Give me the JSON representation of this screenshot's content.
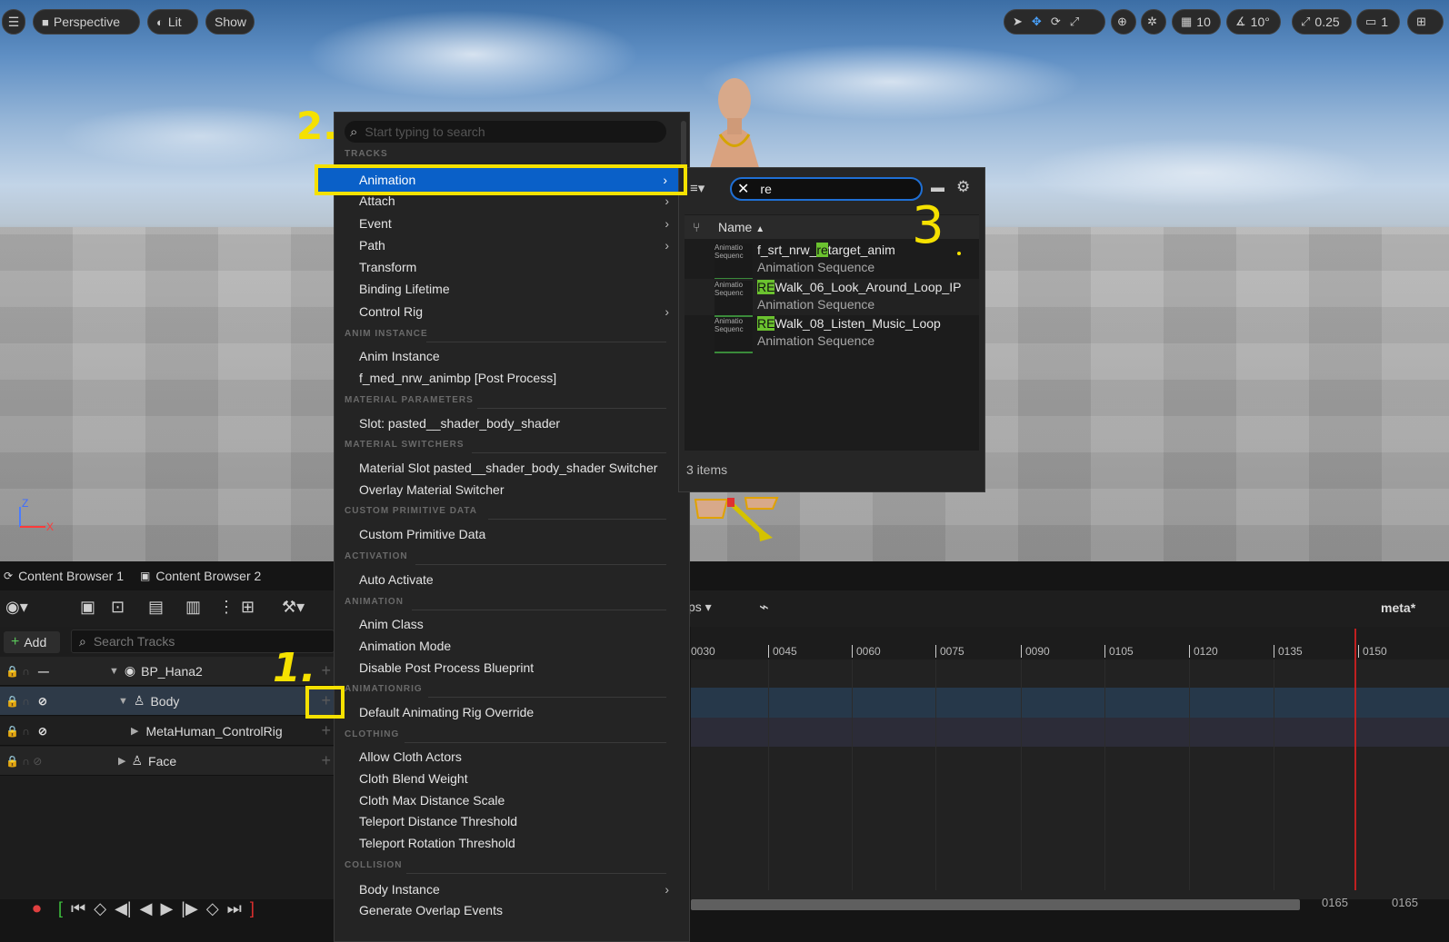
{
  "viewport": {
    "toolbar_left": {
      "perspective": "Perspective",
      "lit": "Lit",
      "show": "Show"
    },
    "toolbar_right": {
      "grid_snap": "10",
      "rot_snap": "10°",
      "scale_snap": "0.25",
      "camera_speed": "1"
    },
    "axis": {
      "z": "Z",
      "x": "X"
    }
  },
  "annotations": {
    "one": "1.",
    "two": "2.",
    "three": "3"
  },
  "content_tabs": [
    "Content Browser 1",
    "Content Browser 2"
  ],
  "sequencer": {
    "add_label": "Add",
    "search_placeholder": "Search Tracks",
    "fps_label": "ps",
    "user_label": "meta",
    "tracks": [
      {
        "label": "BP_Hana2"
      },
      {
        "label": "Body"
      },
      {
        "label": "MetaHuman_ControlRig"
      },
      {
        "label": "Face"
      }
    ],
    "ruler_ticks": [
      "0030",
      "0045",
      "0060",
      "0075",
      "0090",
      "0105",
      "0120",
      "0135",
      "0150"
    ],
    "frame_start": "0165",
    "frame_end": "0165"
  },
  "context_menu": {
    "search_placeholder": "Start typing to search",
    "sections": {
      "tracks": "TRACKS",
      "anim_instance": "ANIM INSTANCE",
      "material_parameters": "MATERIAL PARAMETERS",
      "material_switchers": "MATERIAL SWITCHERS",
      "custom_primitive": "CUSTOM PRIMITIVE DATA",
      "activation": "ACTIVATION",
      "animation": "ANIMATION",
      "animationrig": "ANIMATIONRIG",
      "clothing": "CLOTHING",
      "collision": "COLLISION"
    },
    "items": {
      "animation": "Animation",
      "attach": "Attach",
      "event": "Event",
      "path": "Path",
      "transform": "Transform",
      "binding_lifetime": "Binding Lifetime",
      "control_rig": "Control Rig",
      "anim_instance": "Anim Instance",
      "animbp": "f_med_nrw_animbp [Post Process]",
      "slot": "Slot: pasted__shader_body_shader",
      "mat_slot_switcher": "Material Slot pasted__shader_body_shader Switcher",
      "overlay_switcher": "Overlay Material Switcher",
      "custom_primitive_data": "Custom Primitive Data",
      "auto_activate": "Auto Activate",
      "anim_class": "Anim Class",
      "animation_mode": "Animation Mode",
      "disable_pp": "Disable Post Process Blueprint",
      "default_rig": "Default Animating Rig Override",
      "allow_cloth": "Allow Cloth Actors",
      "cloth_blend": "Cloth Blend Weight",
      "cloth_max": "Cloth Max Distance Scale",
      "teleport_dist": "Teleport Distance Threshold",
      "teleport_rot": "Teleport Rotation Threshold",
      "body_instance": "Body Instance",
      "overlap_events": "Generate Overlap Events"
    }
  },
  "asset_picker": {
    "search_value": "re",
    "column_name": "Name",
    "item_count": "3 items",
    "assets": [
      {
        "pre": "f_srt_nrw_",
        "match": "re",
        "post": "target_anim",
        "type": "Animation Sequence",
        "thumb": "Animatio Sequenc"
      },
      {
        "pre": "",
        "match": "RE",
        "post": "Walk_06_Look_Around_Loop_IP",
        "type": "Animation Sequence",
        "thumb": "Animatio Sequenc"
      },
      {
        "pre": "",
        "match": "RE",
        "post": "Walk_08_Listen_Music_Loop",
        "type": "Animation Sequence",
        "thumb": "Animatio Sequenc"
      }
    ]
  },
  "colors": {
    "accent_blue": "#0a60c8",
    "annotation_yellow": "#f5e100",
    "search_highlight": "#6bc22f"
  }
}
